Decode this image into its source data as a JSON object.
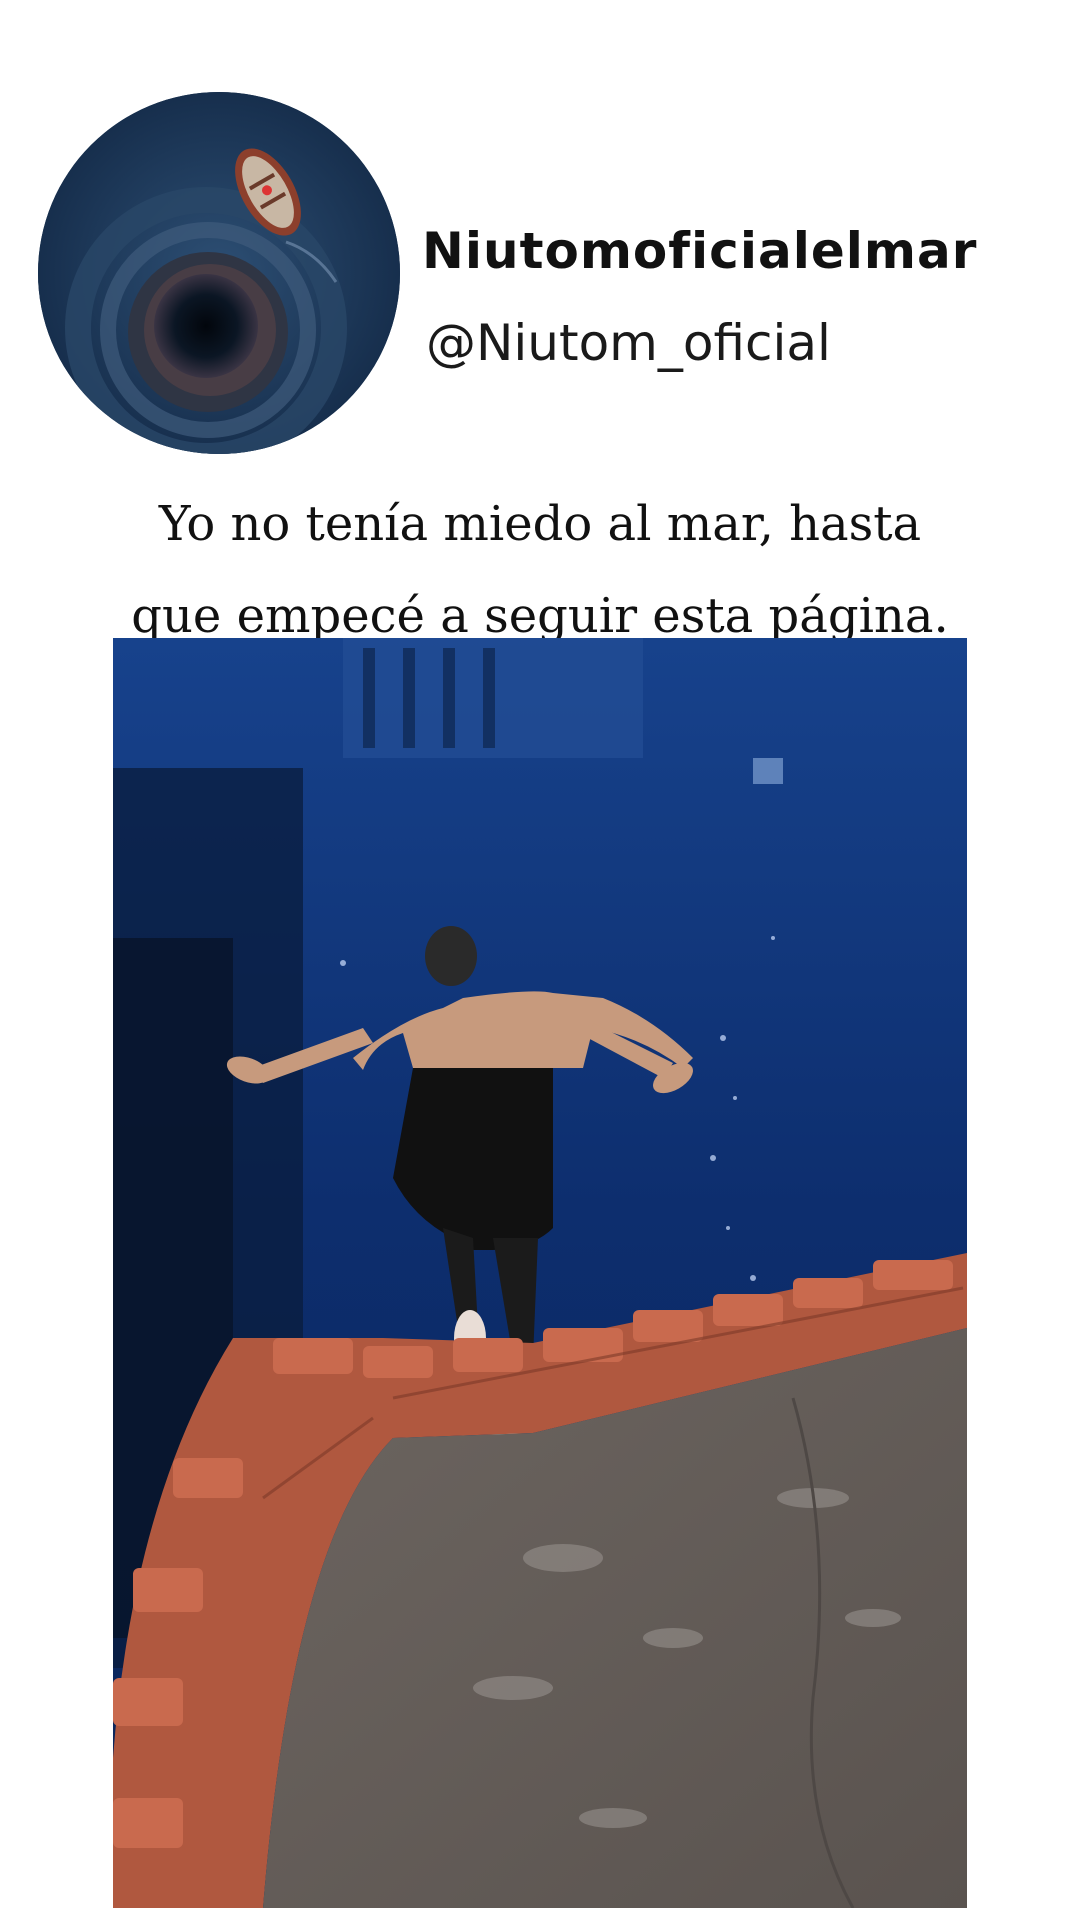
{
  "profile": {
    "display_name": "Niutomoficialelmar",
    "handle": "@Niutom_oficial",
    "avatar_icon": "ocean-whirlpool-boat-avatar"
  },
  "post": {
    "caption_line1": "Yo no tenía miedo al mar, hasta",
    "caption_line2": "que empecé a seguir esta página.",
    "media_description_icon": "aquarium-dive-video"
  },
  "colors": {
    "background": "#ffffff",
    "water": "#0b2c66",
    "brick": "#b0583f",
    "floor": "#6e6660"
  }
}
